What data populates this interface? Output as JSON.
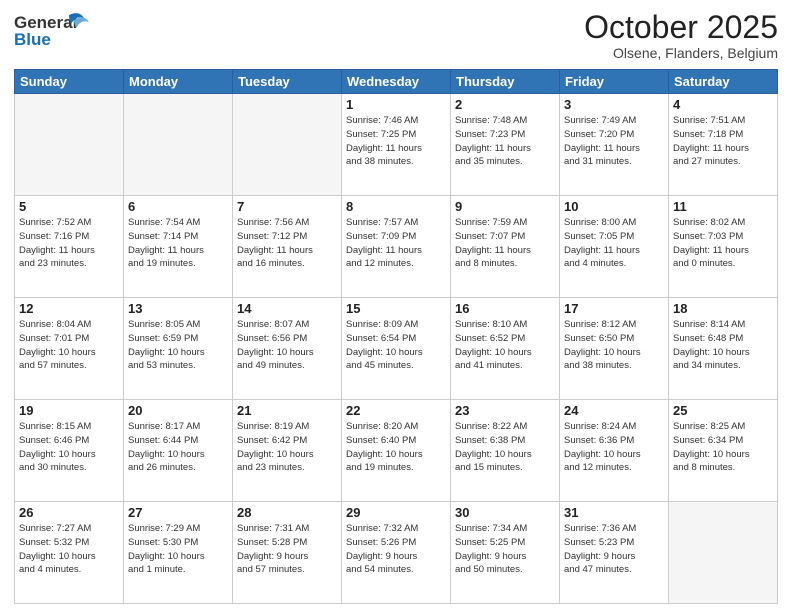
{
  "header": {
    "logo_line1": "General",
    "logo_line2": "Blue",
    "month": "October 2025",
    "location": "Olsene, Flanders, Belgium"
  },
  "weekdays": [
    "Sunday",
    "Monday",
    "Tuesday",
    "Wednesday",
    "Thursday",
    "Friday",
    "Saturday"
  ],
  "weeks": [
    [
      {
        "day": "",
        "info": ""
      },
      {
        "day": "",
        "info": ""
      },
      {
        "day": "",
        "info": ""
      },
      {
        "day": "1",
        "info": "Sunrise: 7:46 AM\nSunset: 7:25 PM\nDaylight: 11 hours\nand 38 minutes."
      },
      {
        "day": "2",
        "info": "Sunrise: 7:48 AM\nSunset: 7:23 PM\nDaylight: 11 hours\nand 35 minutes."
      },
      {
        "day": "3",
        "info": "Sunrise: 7:49 AM\nSunset: 7:20 PM\nDaylight: 11 hours\nand 31 minutes."
      },
      {
        "day": "4",
        "info": "Sunrise: 7:51 AM\nSunset: 7:18 PM\nDaylight: 11 hours\nand 27 minutes."
      }
    ],
    [
      {
        "day": "5",
        "info": "Sunrise: 7:52 AM\nSunset: 7:16 PM\nDaylight: 11 hours\nand 23 minutes."
      },
      {
        "day": "6",
        "info": "Sunrise: 7:54 AM\nSunset: 7:14 PM\nDaylight: 11 hours\nand 19 minutes."
      },
      {
        "day": "7",
        "info": "Sunrise: 7:56 AM\nSunset: 7:12 PM\nDaylight: 11 hours\nand 16 minutes."
      },
      {
        "day": "8",
        "info": "Sunrise: 7:57 AM\nSunset: 7:09 PM\nDaylight: 11 hours\nand 12 minutes."
      },
      {
        "day": "9",
        "info": "Sunrise: 7:59 AM\nSunset: 7:07 PM\nDaylight: 11 hours\nand 8 minutes."
      },
      {
        "day": "10",
        "info": "Sunrise: 8:00 AM\nSunset: 7:05 PM\nDaylight: 11 hours\nand 4 minutes."
      },
      {
        "day": "11",
        "info": "Sunrise: 8:02 AM\nSunset: 7:03 PM\nDaylight: 11 hours\nand 0 minutes."
      }
    ],
    [
      {
        "day": "12",
        "info": "Sunrise: 8:04 AM\nSunset: 7:01 PM\nDaylight: 10 hours\nand 57 minutes."
      },
      {
        "day": "13",
        "info": "Sunrise: 8:05 AM\nSunset: 6:59 PM\nDaylight: 10 hours\nand 53 minutes."
      },
      {
        "day": "14",
        "info": "Sunrise: 8:07 AM\nSunset: 6:56 PM\nDaylight: 10 hours\nand 49 minutes."
      },
      {
        "day": "15",
        "info": "Sunrise: 8:09 AM\nSunset: 6:54 PM\nDaylight: 10 hours\nand 45 minutes."
      },
      {
        "day": "16",
        "info": "Sunrise: 8:10 AM\nSunset: 6:52 PM\nDaylight: 10 hours\nand 41 minutes."
      },
      {
        "day": "17",
        "info": "Sunrise: 8:12 AM\nSunset: 6:50 PM\nDaylight: 10 hours\nand 38 minutes."
      },
      {
        "day": "18",
        "info": "Sunrise: 8:14 AM\nSunset: 6:48 PM\nDaylight: 10 hours\nand 34 minutes."
      }
    ],
    [
      {
        "day": "19",
        "info": "Sunrise: 8:15 AM\nSunset: 6:46 PM\nDaylight: 10 hours\nand 30 minutes."
      },
      {
        "day": "20",
        "info": "Sunrise: 8:17 AM\nSunset: 6:44 PM\nDaylight: 10 hours\nand 26 minutes."
      },
      {
        "day": "21",
        "info": "Sunrise: 8:19 AM\nSunset: 6:42 PM\nDaylight: 10 hours\nand 23 minutes."
      },
      {
        "day": "22",
        "info": "Sunrise: 8:20 AM\nSunset: 6:40 PM\nDaylight: 10 hours\nand 19 minutes."
      },
      {
        "day": "23",
        "info": "Sunrise: 8:22 AM\nSunset: 6:38 PM\nDaylight: 10 hours\nand 15 minutes."
      },
      {
        "day": "24",
        "info": "Sunrise: 8:24 AM\nSunset: 6:36 PM\nDaylight: 10 hours\nand 12 minutes."
      },
      {
        "day": "25",
        "info": "Sunrise: 8:25 AM\nSunset: 6:34 PM\nDaylight: 10 hours\nand 8 minutes."
      }
    ],
    [
      {
        "day": "26",
        "info": "Sunrise: 7:27 AM\nSunset: 5:32 PM\nDaylight: 10 hours\nand 4 minutes."
      },
      {
        "day": "27",
        "info": "Sunrise: 7:29 AM\nSunset: 5:30 PM\nDaylight: 10 hours\nand 1 minute."
      },
      {
        "day": "28",
        "info": "Sunrise: 7:31 AM\nSunset: 5:28 PM\nDaylight: 9 hours\nand 57 minutes."
      },
      {
        "day": "29",
        "info": "Sunrise: 7:32 AM\nSunset: 5:26 PM\nDaylight: 9 hours\nand 54 minutes."
      },
      {
        "day": "30",
        "info": "Sunrise: 7:34 AM\nSunset: 5:25 PM\nDaylight: 9 hours\nand 50 minutes."
      },
      {
        "day": "31",
        "info": "Sunrise: 7:36 AM\nSunset: 5:23 PM\nDaylight: 9 hours\nand 47 minutes."
      },
      {
        "day": "",
        "info": ""
      }
    ]
  ]
}
